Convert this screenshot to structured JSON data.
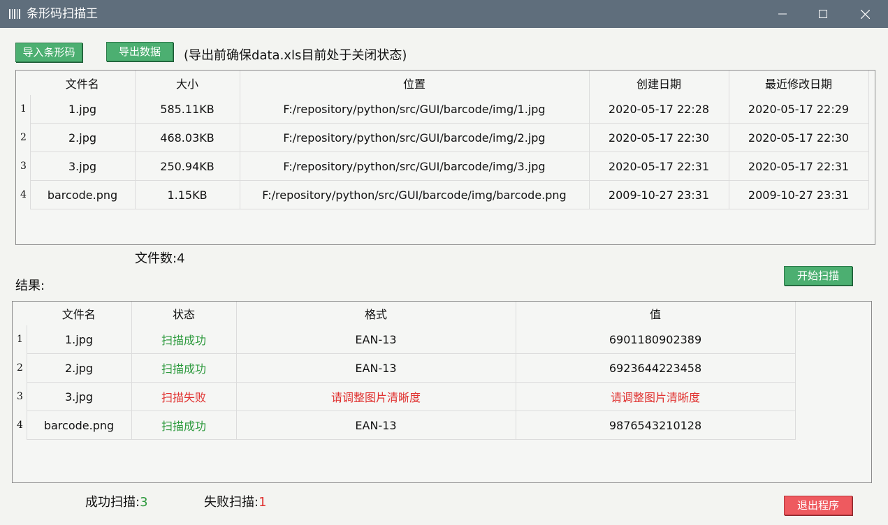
{
  "window": {
    "title": "条形码扫描王"
  },
  "colors": {
    "titlebar": "#5f6e7c",
    "button_green": "#4caf71",
    "button_red": "#ee5a5f",
    "success": "#2e9a3e",
    "fail": "#e0312f"
  },
  "toolbar": {
    "import_label": "导入条形码",
    "export_label": "导出数据",
    "note": "(导出前确保data.xls目前处于关闭状态)"
  },
  "files_table": {
    "columns": [
      "文件名",
      "大小",
      "位置",
      "创建日期",
      "最近修改日期"
    ],
    "rows": [
      {
        "num": "1",
        "name": "1.jpg",
        "size": "585.11KB",
        "path": "F:/repository/python/src/GUI/barcode/img/1.jpg",
        "created": "2020-05-17 22:28",
        "modified": "2020-05-17 22:29"
      },
      {
        "num": "2",
        "name": "2.jpg",
        "size": "468.03KB",
        "path": "F:/repository/python/src/GUI/barcode/img/2.jpg",
        "created": "2020-05-17 22:30",
        "modified": "2020-05-17 22:30"
      },
      {
        "num": "3",
        "name": "3.jpg",
        "size": "250.94KB",
        "path": "F:/repository/python/src/GUI/barcode/img/3.jpg",
        "created": "2020-05-17 22:31",
        "modified": "2020-05-17 22:31"
      },
      {
        "num": "4",
        "name": "barcode.png",
        "size": "1.15KB",
        "path": "F:/repository/python/src/GUI/barcode/img/barcode.png",
        "created": "2009-10-27 23:31",
        "modified": "2009-10-27 23:31"
      }
    ]
  },
  "file_count": {
    "label": "文件数:",
    "value": "4"
  },
  "start_scan_label": "开始扫描",
  "results_label": "结果:",
  "results_table": {
    "columns": [
      "文件名",
      "状态",
      "格式",
      "值"
    ],
    "rows": [
      {
        "num": "1",
        "name": "1.jpg",
        "status": "扫描成功",
        "ok": true,
        "format": "EAN-13",
        "value": "6901180902389"
      },
      {
        "num": "2",
        "name": "2.jpg",
        "status": "扫描成功",
        "ok": true,
        "format": "EAN-13",
        "value": "6923644223458"
      },
      {
        "num": "3",
        "name": "3.jpg",
        "status": "扫描失败",
        "ok": false,
        "format": "请调整图片清晰度",
        "value": "请调整图片清晰度"
      },
      {
        "num": "4",
        "name": "barcode.png",
        "status": "扫描成功",
        "ok": true,
        "format": "EAN-13",
        "value": "9876543210128"
      }
    ]
  },
  "summary": {
    "success_label": "成功扫描:",
    "success_value": "3",
    "fail_label": "失败扫描:",
    "fail_value": "1"
  },
  "exit_label": "退出程序"
}
